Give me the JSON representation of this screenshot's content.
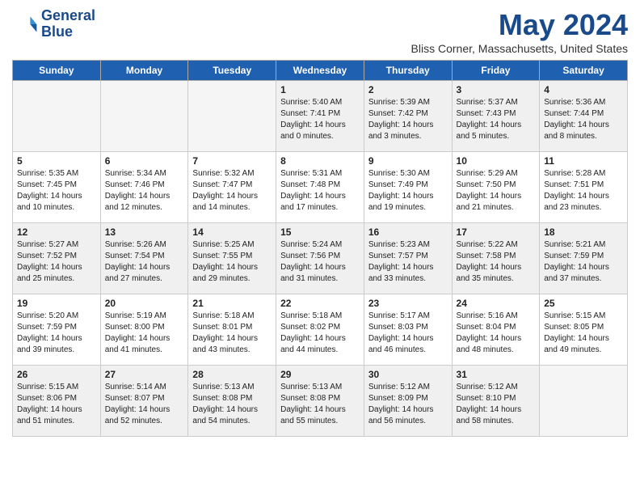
{
  "header": {
    "logo_line1": "General",
    "logo_line2": "Blue",
    "month": "May 2024",
    "location": "Bliss Corner, Massachusetts, United States"
  },
  "weekdays": [
    "Sunday",
    "Monday",
    "Tuesday",
    "Wednesday",
    "Thursday",
    "Friday",
    "Saturday"
  ],
  "weeks": [
    [
      {
        "day": "",
        "info": "",
        "empty": true
      },
      {
        "day": "",
        "info": "",
        "empty": true
      },
      {
        "day": "",
        "info": "",
        "empty": true
      },
      {
        "day": "1",
        "info": "Sunrise: 5:40 AM\nSunset: 7:41 PM\nDaylight: 14 hours\nand 0 minutes.",
        "empty": false
      },
      {
        "day": "2",
        "info": "Sunrise: 5:39 AM\nSunset: 7:42 PM\nDaylight: 14 hours\nand 3 minutes.",
        "empty": false
      },
      {
        "day": "3",
        "info": "Sunrise: 5:37 AM\nSunset: 7:43 PM\nDaylight: 14 hours\nand 5 minutes.",
        "empty": false
      },
      {
        "day": "4",
        "info": "Sunrise: 5:36 AM\nSunset: 7:44 PM\nDaylight: 14 hours\nand 8 minutes.",
        "empty": false
      }
    ],
    [
      {
        "day": "5",
        "info": "Sunrise: 5:35 AM\nSunset: 7:45 PM\nDaylight: 14 hours\nand 10 minutes.",
        "empty": false
      },
      {
        "day": "6",
        "info": "Sunrise: 5:34 AM\nSunset: 7:46 PM\nDaylight: 14 hours\nand 12 minutes.",
        "empty": false
      },
      {
        "day": "7",
        "info": "Sunrise: 5:32 AM\nSunset: 7:47 PM\nDaylight: 14 hours\nand 14 minutes.",
        "empty": false
      },
      {
        "day": "8",
        "info": "Sunrise: 5:31 AM\nSunset: 7:48 PM\nDaylight: 14 hours\nand 17 minutes.",
        "empty": false
      },
      {
        "day": "9",
        "info": "Sunrise: 5:30 AM\nSunset: 7:49 PM\nDaylight: 14 hours\nand 19 minutes.",
        "empty": false
      },
      {
        "day": "10",
        "info": "Sunrise: 5:29 AM\nSunset: 7:50 PM\nDaylight: 14 hours\nand 21 minutes.",
        "empty": false
      },
      {
        "day": "11",
        "info": "Sunrise: 5:28 AM\nSunset: 7:51 PM\nDaylight: 14 hours\nand 23 minutes.",
        "empty": false
      }
    ],
    [
      {
        "day": "12",
        "info": "Sunrise: 5:27 AM\nSunset: 7:52 PM\nDaylight: 14 hours\nand 25 minutes.",
        "empty": false
      },
      {
        "day": "13",
        "info": "Sunrise: 5:26 AM\nSunset: 7:54 PM\nDaylight: 14 hours\nand 27 minutes.",
        "empty": false
      },
      {
        "day": "14",
        "info": "Sunrise: 5:25 AM\nSunset: 7:55 PM\nDaylight: 14 hours\nand 29 minutes.",
        "empty": false
      },
      {
        "day": "15",
        "info": "Sunrise: 5:24 AM\nSunset: 7:56 PM\nDaylight: 14 hours\nand 31 minutes.",
        "empty": false
      },
      {
        "day": "16",
        "info": "Sunrise: 5:23 AM\nSunset: 7:57 PM\nDaylight: 14 hours\nand 33 minutes.",
        "empty": false
      },
      {
        "day": "17",
        "info": "Sunrise: 5:22 AM\nSunset: 7:58 PM\nDaylight: 14 hours\nand 35 minutes.",
        "empty": false
      },
      {
        "day": "18",
        "info": "Sunrise: 5:21 AM\nSunset: 7:59 PM\nDaylight: 14 hours\nand 37 minutes.",
        "empty": false
      }
    ],
    [
      {
        "day": "19",
        "info": "Sunrise: 5:20 AM\nSunset: 7:59 PM\nDaylight: 14 hours\nand 39 minutes.",
        "empty": false
      },
      {
        "day": "20",
        "info": "Sunrise: 5:19 AM\nSunset: 8:00 PM\nDaylight: 14 hours\nand 41 minutes.",
        "empty": false
      },
      {
        "day": "21",
        "info": "Sunrise: 5:18 AM\nSunset: 8:01 PM\nDaylight: 14 hours\nand 43 minutes.",
        "empty": false
      },
      {
        "day": "22",
        "info": "Sunrise: 5:18 AM\nSunset: 8:02 PM\nDaylight: 14 hours\nand 44 minutes.",
        "empty": false
      },
      {
        "day": "23",
        "info": "Sunrise: 5:17 AM\nSunset: 8:03 PM\nDaylight: 14 hours\nand 46 minutes.",
        "empty": false
      },
      {
        "day": "24",
        "info": "Sunrise: 5:16 AM\nSunset: 8:04 PM\nDaylight: 14 hours\nand 48 minutes.",
        "empty": false
      },
      {
        "day": "25",
        "info": "Sunrise: 5:15 AM\nSunset: 8:05 PM\nDaylight: 14 hours\nand 49 minutes.",
        "empty": false
      }
    ],
    [
      {
        "day": "26",
        "info": "Sunrise: 5:15 AM\nSunset: 8:06 PM\nDaylight: 14 hours\nand 51 minutes.",
        "empty": false
      },
      {
        "day": "27",
        "info": "Sunrise: 5:14 AM\nSunset: 8:07 PM\nDaylight: 14 hours\nand 52 minutes.",
        "empty": false
      },
      {
        "day": "28",
        "info": "Sunrise: 5:13 AM\nSunset: 8:08 PM\nDaylight: 14 hours\nand 54 minutes.",
        "empty": false
      },
      {
        "day": "29",
        "info": "Sunrise: 5:13 AM\nSunset: 8:08 PM\nDaylight: 14 hours\nand 55 minutes.",
        "empty": false
      },
      {
        "day": "30",
        "info": "Sunrise: 5:12 AM\nSunset: 8:09 PM\nDaylight: 14 hours\nand 56 minutes.",
        "empty": false
      },
      {
        "day": "31",
        "info": "Sunrise: 5:12 AM\nSunset: 8:10 PM\nDaylight: 14 hours\nand 58 minutes.",
        "empty": false
      },
      {
        "day": "",
        "info": "",
        "empty": true
      }
    ]
  ]
}
